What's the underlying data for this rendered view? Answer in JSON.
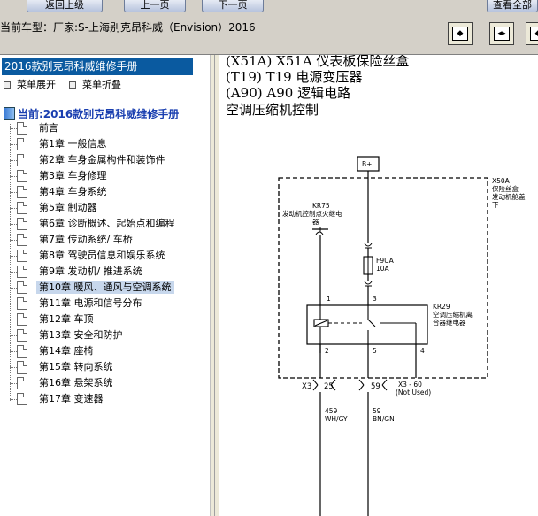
{
  "toolbar": {
    "back_label": "返回上级",
    "prev_label": "上一页",
    "next_label": "下一页",
    "right_label": "查看全部"
  },
  "current_model": "当前车型：厂家:S-上海别克昂科威（Envision）2016",
  "nav_buttons": [
    "nav-first-icon",
    "nav-split-icon",
    "nav-last-icon"
  ],
  "left": {
    "panel_title": "2016款别克昂科威维修手册",
    "expand_label": "菜单展开",
    "collapse_label": "菜单折叠",
    "root_label": "当前:2016款别克昂科威维修手册",
    "items": [
      {
        "label": "前言"
      },
      {
        "label": "第1章  一般信息"
      },
      {
        "label": "第2章  车身金属构件和装饰件"
      },
      {
        "label": "第3章  车身修理"
      },
      {
        "label": "第4章  车身系统"
      },
      {
        "label": "第5章  制动器"
      },
      {
        "label": "第6章  诊断概述、起始点和编程"
      },
      {
        "label": "第7章  传动系统/ 车桥"
      },
      {
        "label": "第8章  驾驶员信息和娱乐系统"
      },
      {
        "label": "第9章  发动机/ 推进系统"
      },
      {
        "label": "第10章  暖风、通风与空调系统"
      },
      {
        "label": "第11章  电源和信号分布"
      },
      {
        "label": "第12章  车顶"
      },
      {
        "label": "第13章  安全和防护"
      },
      {
        "label": "第14章  座椅"
      },
      {
        "label": "第15章  转向系统"
      },
      {
        "label": "第16章  悬架系统"
      },
      {
        "label": "第17章  变速器"
      }
    ],
    "selected_index": 10
  },
  "content": {
    "lines": [
      "(X51A) X51A 仪表板保险丝盒",
      "(T19) T19 电源变压器",
      "(A90) A90 逻辑电路",
      "空调压缩机控制"
    ],
    "diagram": {
      "power_label": "B+",
      "box_id": "X50A",
      "box_desc": [
        "保险丝盒",
        "发动机舱盖",
        "下"
      ],
      "relay_id": "KR75",
      "relay_desc": [
        "发动机控制点火继电",
        "器"
      ],
      "fuse_id": "F9UA",
      "fuse_rating": "10A",
      "relay2_id": "KR29",
      "relay2_desc": [
        "空调压缩机离",
        "合器继电器"
      ],
      "pins_top": [
        "1",
        "3"
      ],
      "pins_bottom": [
        "2",
        "5",
        "4"
      ],
      "connector": "X3",
      "conn_pins": [
        "25",
        "59"
      ],
      "conn_note": "X3 - 60",
      "conn_note2": "(Not Used)",
      "wire1_num": "459",
      "wire1_color": "WH/GY",
      "wire2_num": "59",
      "wire2_color": "BN/GN"
    }
  }
}
